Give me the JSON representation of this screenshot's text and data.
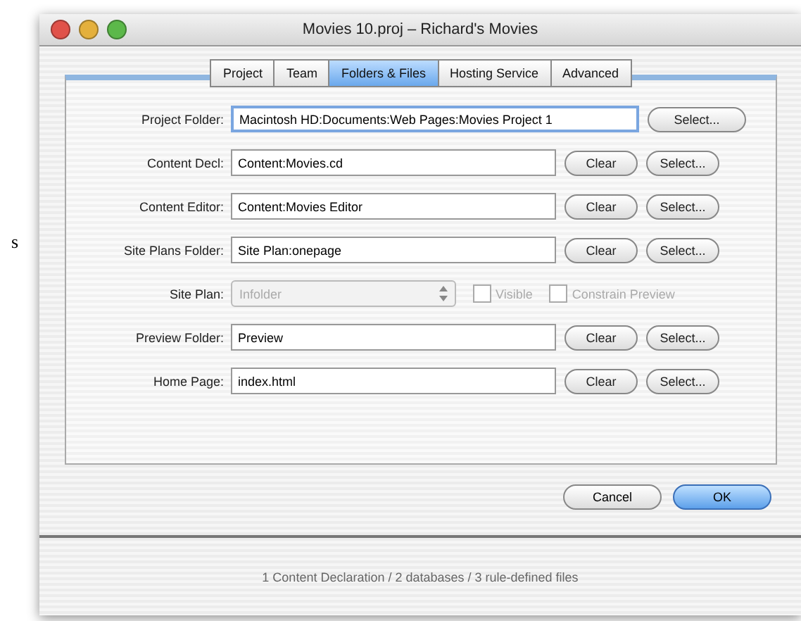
{
  "background_fragment": "s",
  "window": {
    "title": "Movies 10.proj – Richard's Movies"
  },
  "tabs": [
    {
      "label": "Project",
      "selected": false
    },
    {
      "label": "Team",
      "selected": false
    },
    {
      "label": "Folders & Files",
      "selected": true
    },
    {
      "label": "Hosting Service",
      "selected": false
    },
    {
      "label": "Advanced",
      "selected": false
    }
  ],
  "rows": [
    {
      "kind": "field",
      "label": "Project Folder:",
      "value": "Macintosh HD:Documents:Web Pages:Movies Project 1",
      "focused": true,
      "buttons": [
        "Select..."
      ]
    },
    {
      "kind": "field",
      "label": "Content Decl:",
      "value": "Content:Movies.cd",
      "focused": false,
      "buttons": [
        "Clear",
        "Select..."
      ]
    },
    {
      "kind": "field",
      "label": "Content Editor:",
      "value": "Content:Movies Editor",
      "focused": false,
      "buttons": [
        "Clear",
        "Select..."
      ]
    },
    {
      "kind": "field",
      "label": "Site Plans Folder:",
      "value": "Site Plan:onepage",
      "focused": false,
      "buttons": [
        "Clear",
        "Select..."
      ]
    },
    {
      "kind": "popup",
      "label": "Site Plan:",
      "value": "Infolder",
      "disabled": true,
      "checkboxes": [
        {
          "label": "Visible",
          "checked": false
        },
        {
          "label": "Constrain Preview",
          "checked": false
        }
      ]
    },
    {
      "kind": "field",
      "label": "Preview Folder:",
      "value": "Preview",
      "focused": false,
      "buttons": [
        "Clear",
        "Select..."
      ]
    },
    {
      "kind": "field",
      "label": "Home Page:",
      "value": "index.html",
      "focused": false,
      "buttons": [
        "Clear",
        "Select..."
      ]
    }
  ],
  "buttons": [
    {
      "label": "Cancel",
      "default": false
    },
    {
      "label": "OK",
      "default": true
    }
  ],
  "status_bar": "1 Content Declaration / 2 databases / 3 rule-defined files"
}
